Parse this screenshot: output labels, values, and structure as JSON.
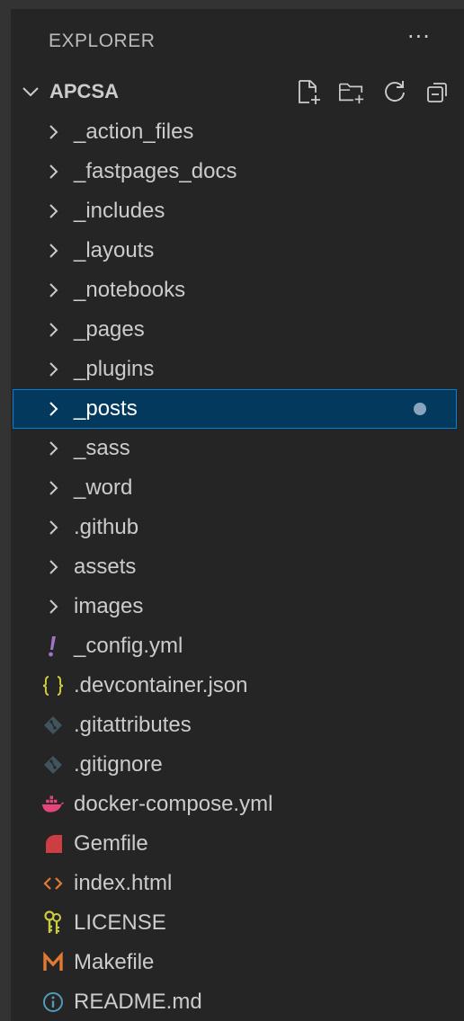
{
  "explorer": {
    "title": "EXPLORER",
    "more_label": "···"
  },
  "section": {
    "title": "APCSA",
    "actions": [
      "new-file-icon",
      "new-folder-icon",
      "refresh-icon",
      "collapse-all-icon"
    ]
  },
  "tree": {
    "folders": [
      {
        "label": "_action_files"
      },
      {
        "label": "_fastpages_docs"
      },
      {
        "label": "_includes"
      },
      {
        "label": "_layouts"
      },
      {
        "label": "_notebooks"
      },
      {
        "label": "_pages"
      },
      {
        "label": "_plugins"
      },
      {
        "label": "_posts",
        "selected": true,
        "modified": true
      },
      {
        "label": "_sass"
      },
      {
        "label": "_word"
      },
      {
        "label": ".github"
      },
      {
        "label": "assets"
      },
      {
        "label": "images"
      }
    ],
    "files": [
      {
        "label": "_config.yml",
        "icon": "yaml-exclamation-icon",
        "color": "#a074c4"
      },
      {
        "label": ".devcontainer.json",
        "icon": "json-braces-icon",
        "color": "#cbcb41"
      },
      {
        "label": ".gitattributes",
        "icon": "git-diamond-icon",
        "color": "#41535b"
      },
      {
        "label": ".gitignore",
        "icon": "git-diamond-icon",
        "color": "#41535b"
      },
      {
        "label": "docker-compose.yml",
        "icon": "docker-whale-icon",
        "color": "#e5467a"
      },
      {
        "label": "Gemfile",
        "icon": "ruby-gem-icon",
        "color": "#cc3e44"
      },
      {
        "label": "index.html",
        "icon": "html-brackets-icon",
        "color": "#e37933"
      },
      {
        "label": "LICENSE",
        "icon": "license-key-icon",
        "color": "#cbcb41"
      },
      {
        "label": "Makefile",
        "icon": "makefile-m-icon",
        "color": "#e37933"
      },
      {
        "label": "README.md",
        "icon": "info-circle-icon",
        "color": "#519aba"
      }
    ]
  },
  "colors": {
    "background": "#252526",
    "selection": "#04395e",
    "focus_border": "#007fd4",
    "text": "#cccccc"
  }
}
